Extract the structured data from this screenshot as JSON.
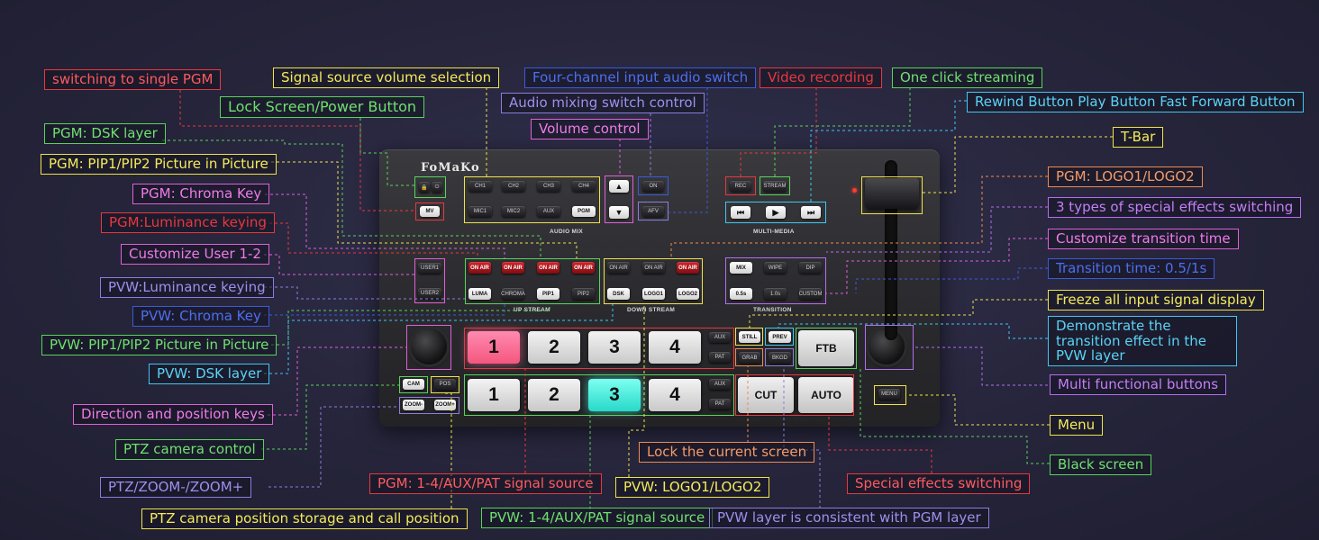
{
  "device": {
    "brand": "FoMaKo",
    "audio_mix_label": "AUDIO MIX",
    "multimedia_label": "MULTI-MEDIA",
    "upstream_label": "UP STREAM",
    "downstream_label": "DOWN STREAM",
    "transition_label": "TRANSITION",
    "buttons": {
      "mv": "MV",
      "ch1": "CH1",
      "ch2": "CH2",
      "ch3": "CH3",
      "ch4": "CH4",
      "mic1": "MIC1",
      "mic2": "MIC2",
      "aux": "AUX",
      "pgm": "PGM",
      "vol_up": "▲",
      "vol_down": "▼",
      "on": "ON",
      "afv": "AFV",
      "rec": "REC",
      "stream": "STREAM",
      "rewind": "⏮",
      "play": "▶",
      "ffwd": "⏭",
      "user1": "USER1",
      "user2": "USER2",
      "on_air": "ON AIR",
      "luma": "LUMA",
      "chroma": "CHROMA",
      "pip1": "PIP1",
      "pip2": "PIP2",
      "dsk": "DSK",
      "logo1": "LOGO1",
      "logo2": "LOGO2",
      "mix": "MIX",
      "wipe": "WIPE",
      "dip": "DIP",
      "t05": "0.5s",
      "t10": "1.0s",
      "custom": "CUSTOM",
      "still": "STILL",
      "prev": "PREV",
      "grab": "GRAB",
      "bkgd": "BKGD",
      "ftb": "FTB",
      "cut": "CUT",
      "auto": "AUTO",
      "cam": "CAM",
      "pos": "POS",
      "zoom_minus": "ZOOM-",
      "zoom_plus": "ZOOM+",
      "menu": "MENU",
      "pat": "PAT",
      "n1": "1",
      "n2": "2",
      "n3": "3",
      "n4": "4"
    }
  },
  "colors": {
    "red": "#e8373e",
    "green": "#58d35a",
    "yellow": "#f0e24a",
    "pink": "#e05fd6",
    "purple": "#8b7dde",
    "blue": "#3a5bd9",
    "cyan": "#3fc7f0",
    "orange": "#f08a50",
    "violet": "#b56df0"
  },
  "callouts": {
    "c1": "switching to single PGM",
    "c2": "Lock Screen/Power Button",
    "c3": "PGM: DSK layer",
    "c4": "PGM: PIP1/PIP2 Picture in Picture",
    "c5": "PGM: Chroma Key",
    "c6": "PGM:Luminance keying",
    "c7": "Customize User 1-2",
    "c8": "PVW:Luminance keying",
    "c9": "PVW: Chroma Key",
    "c10": "PVW: PIP1/PIP2 Picture in Picture",
    "c11": "PVW: DSK layer",
    "c12": "Direction and position keys",
    "c13": "PTZ camera control",
    "c14": "PTZ/ZOOM-/ZOOM+",
    "c15": "PTZ camera position storage and call position",
    "c16": "Signal source volume selection",
    "c17": "Four-channel input audio switch",
    "c18": "Audio mixing switch control",
    "c19": "Volume control",
    "c20": "Video recording",
    "c21": "One click streaming",
    "c22": "Rewind Button Play Button Fast Forward Button",
    "c23": "T-Bar",
    "c24": "PGM: LOGO1/LOGO2",
    "c25": "3 types of special effects switching",
    "c26": "Customize transition time",
    "c27": "Transition time: 0.5/1s",
    "c28": "Freeze all input signal display",
    "c29": "Demonstrate the transition effect in the PVW layer",
    "c30": "Multi functional buttons",
    "c31": "Menu",
    "c32": "Black screen",
    "c33": "Lock the current screen",
    "c34": "PGM: 1-4/AUX/PAT signal source",
    "c35": "PVW: LOGO1/LOGO2",
    "c36": "PVW: 1-4/AUX/PAT signal source",
    "c37": "PVW layer is consistent with PGM layer",
    "c38": "Special effects switching"
  }
}
